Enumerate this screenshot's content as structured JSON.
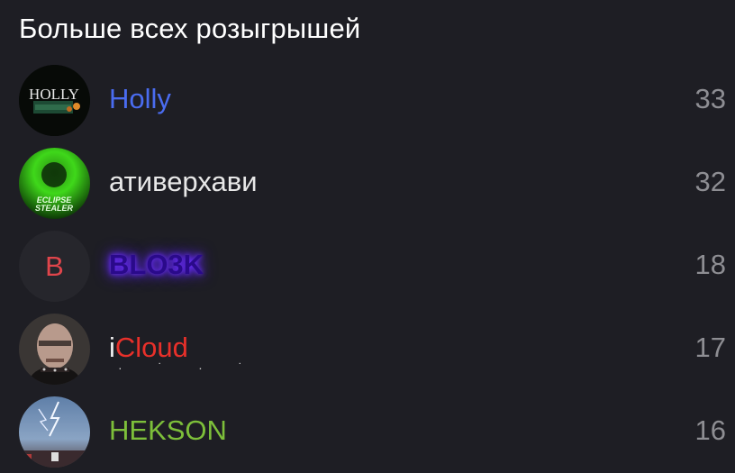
{
  "header": {
    "title": "Больше всех розыгрышей"
  },
  "rows": [
    {
      "name": "Holly",
      "count": "33",
      "name_color": "#4a6cf0",
      "avatar_text": "HOLLY",
      "avatar_icon": "holly-avatar-icon"
    },
    {
      "name": "ативерхави",
      "count": "32",
      "name_color": "#e8e8e8",
      "avatar_text": "ECLIPSE STEALER",
      "avatar_icon": "eclipse-stealer-avatar-icon"
    },
    {
      "name": "BLO3K",
      "count": "18",
      "name_color": "#2a0a8a",
      "avatar_letter": "B",
      "avatar_icon": "letter-avatar"
    },
    {
      "name_first": "i",
      "name_rest": "Cloud",
      "count": "17",
      "name_color": "#e8302a",
      "avatar_icon": "face-avatar-icon"
    },
    {
      "name": "HEKSON",
      "count": "16",
      "name_color": "#7dbf3a",
      "avatar_icon": "lightning-avatar-icon"
    }
  ]
}
